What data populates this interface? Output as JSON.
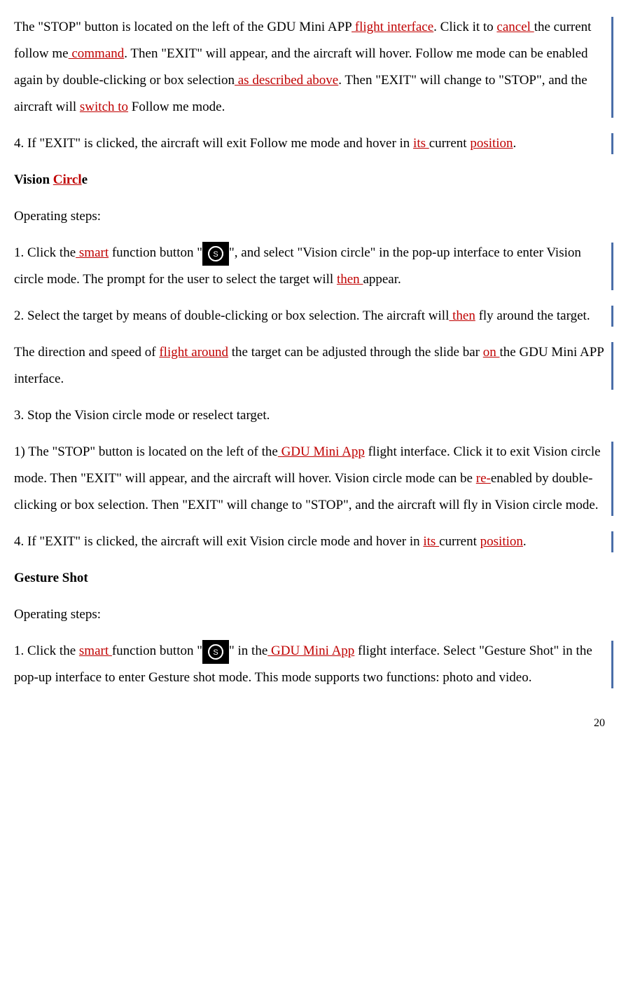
{
  "p1": {
    "t1": "The \"STOP\" button is located on the left of the GDU Mini APP",
    "r1": " flight interface",
    "t2": ". Click it to ",
    "r2": "cancel ",
    "t3": "the current follow me",
    "r3": " command",
    "t4": ". Then \"EXIT\" will appear, and the aircraft will hover. Follow me mode can be enabled again by double-clicking or box selection",
    "r4": " as described above",
    "t5": ". Then \"EXIT\" will change to \"STOP\", and the aircraft will ",
    "r5": "switch to",
    "t6": " Follow me mode."
  },
  "p2": {
    "t1": "4.  If \"EXIT\" is clicked, the aircraft will exit Follow me mode and hover in ",
    "r1": "its ",
    "t2": "current ",
    "r2": "position",
    "t3": "."
  },
  "h1": {
    "t1": "Vision ",
    "r1": "Circl",
    "t2": "e"
  },
  "p3": "Operating steps:",
  "p4": {
    "t1": "1. Click the",
    "r1": " smart",
    "t2": " function button \"",
    "icon": "⦾",
    "t3": "\", and select \"Vision circle\" in the pop-up interface to enter Vision circle",
    "t4": " mode. The prompt for the user to select the target will ",
    "r2": "then ",
    "t5": "appear."
  },
  "p5": {
    "t1": "2. Select the target by means of double-clicking or box selection. The aircraft will",
    "r1": " then",
    "t2": " fly around the target."
  },
  "p6": {
    "t1": "The direction and speed of ",
    "r1": "flight around",
    "t2": " the target can be adjusted through the slide bar ",
    "r2": "on ",
    "t3": "the GDU Mini APP interface."
  },
  "p7": "3.  Stop the Vision circle mode or reselect target.",
  "p8": {
    "t1": "1) The \"STOP\" button is located on the left of the",
    "r1": " GDU Mini App",
    "t2": " flight interface. Click it to exit Vision circle mode. Then \"EXIT\" will appear, and the aircraft will hover. Vision circle mode can be ",
    "r2": "re-",
    "t3": "enabled by double-clicking or box selection. Then \"EXIT\" will change to \"STOP\", and the aircraft will fly in Vision circle mode."
  },
  "p9": {
    "t1": "4. If \"EXIT\" is clicked, the aircraft will exit Vision circle mode and hover in ",
    "r1": "its ",
    "t2": "current ",
    "r2": "position",
    "t3": "."
  },
  "h2": "Gesture Shot",
  "p10": "Operating steps:",
  "p11": {
    "t1": "1. Click the ",
    "r1": "smart ",
    "t2": "function button \"",
    "icon": "⦾",
    "t3": "\" in the",
    "r2": " GDU Mini App",
    "t4": " flight interface. Select \"Gesture Shot\" in the pop-up interface to enter Gesture shot mode. This mode supports two functions: photo and video."
  },
  "pageNumber": "20"
}
